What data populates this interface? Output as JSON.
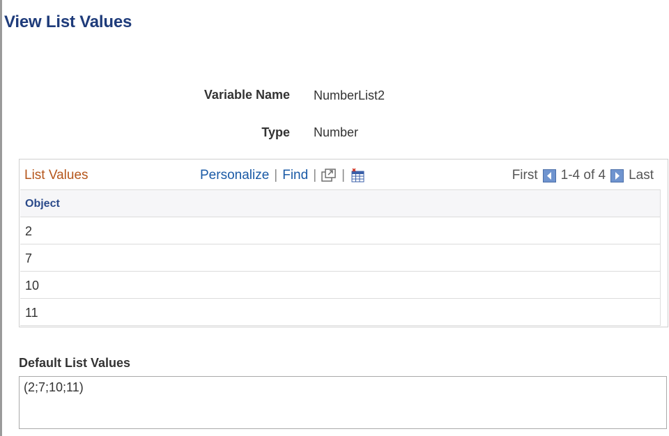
{
  "page": {
    "title": "View List Values"
  },
  "fields": {
    "variable_name": {
      "label": "Variable Name",
      "value": "NumberList2"
    },
    "type": {
      "label": "Type",
      "value": "Number"
    }
  },
  "grid": {
    "title": "List Values",
    "tools": {
      "personalize": "Personalize",
      "find": "Find",
      "separator": "|",
      "view_all_icon": "new-window-icon",
      "download_icon": "spreadsheet-download-icon"
    },
    "nav": {
      "first": "First",
      "range": "1-4 of 4",
      "last": "Last",
      "prev_icon": "arrow-left-icon",
      "next_icon": "arrow-right-icon"
    },
    "column_header": "Object",
    "rows": [
      "2",
      "7",
      "10",
      "11"
    ]
  },
  "default_list": {
    "label": "Default List Values",
    "value": "(2;7;10;11)"
  },
  "colors": {
    "title": "#1e3b7a",
    "grid_title": "#b5561b",
    "link": "#1a5aa6",
    "nav_button": "#5b86c5"
  }
}
